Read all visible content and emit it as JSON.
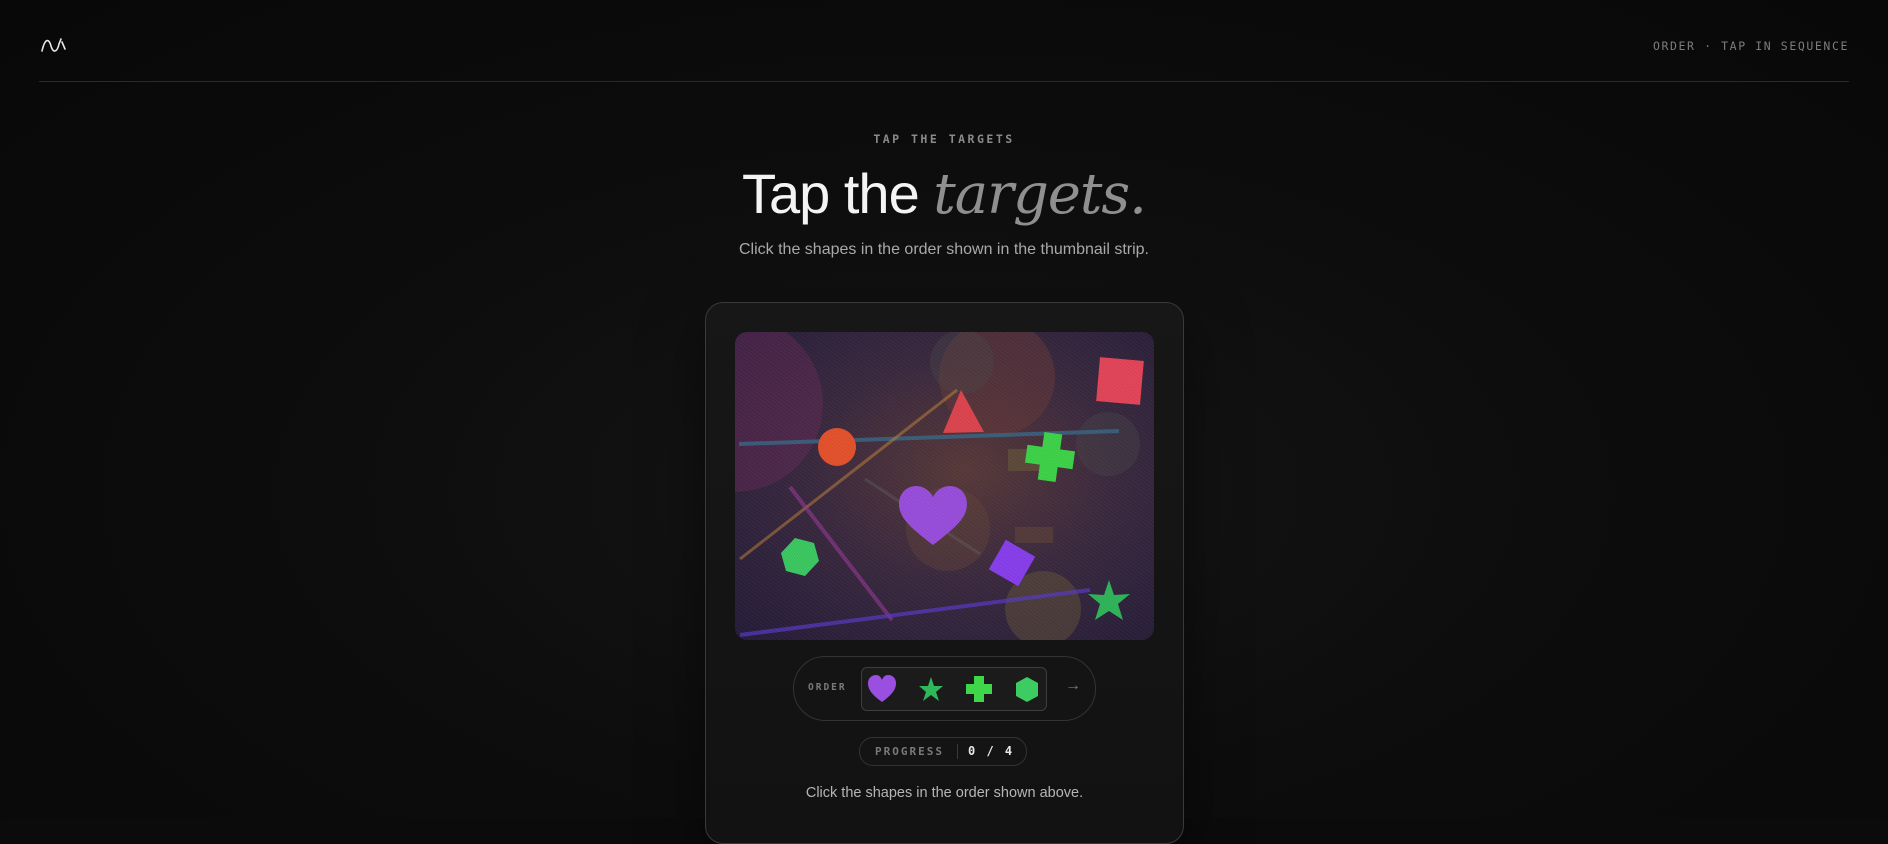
{
  "header": {
    "logo_icon": "wave-logo-icon",
    "mode_label": "ORDER · TAP IN SEQUENCE"
  },
  "hero": {
    "eyebrow": "TAP THE TARGETS",
    "title_plain": "Tap the ",
    "title_italic": "targets.",
    "subtitle": "Click the shapes in the order shown in the thumbnail strip."
  },
  "canvas": {
    "shapes": [
      {
        "name": "red-square-target",
        "shape": "square",
        "color": "#e8455a"
      },
      {
        "name": "red-triangle-target",
        "shape": "triangle",
        "color": "#e04550"
      },
      {
        "name": "orange-circle-target",
        "shape": "circle",
        "color": "#e8532c"
      },
      {
        "name": "green-cross-target",
        "shape": "cross",
        "color": "#3fd64a"
      },
      {
        "name": "purple-heart-target",
        "shape": "heart",
        "color": "#9b4fe0"
      },
      {
        "name": "green-hexagon-target",
        "shape": "hexagon",
        "color": "#3ccc62"
      },
      {
        "name": "violet-diamond-target",
        "shape": "diamond",
        "color": "#8a3ff0"
      },
      {
        "name": "green-star-target",
        "shape": "star",
        "color": "#2fb85a"
      }
    ]
  },
  "order": {
    "label": "ORDER",
    "items": [
      {
        "name": "heart-icon",
        "color": "#9b4fe0"
      },
      {
        "name": "star-icon",
        "color": "#2fb85a"
      },
      {
        "name": "cross-icon",
        "color": "#3fd64a"
      },
      {
        "name": "hexagon-icon",
        "color": "#3ccc62"
      }
    ],
    "arrow": "→"
  },
  "progress": {
    "label": "PROGRESS",
    "value": "0 / 4",
    "done": 0,
    "total": 4
  },
  "instruction": "Click the shapes in the order shown above."
}
